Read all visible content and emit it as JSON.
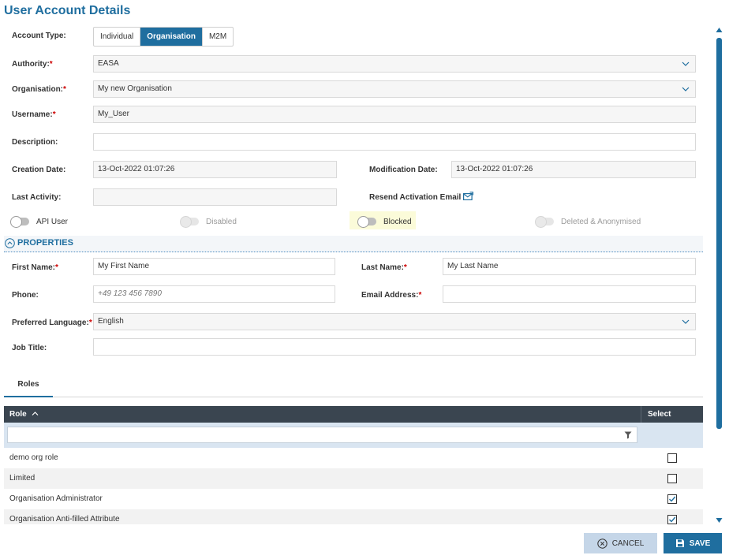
{
  "page": {
    "title": "User Account Details"
  },
  "account_type": {
    "label": "Account Type:",
    "options": [
      "Individual",
      "Organisation",
      "M2M"
    ],
    "selected": "Organisation"
  },
  "authority": {
    "label": "Authority:",
    "value": "EASA"
  },
  "organisation": {
    "label": "Organisation:",
    "value": "My new Organisation"
  },
  "username": {
    "label": "Username:",
    "value": "My_User"
  },
  "description": {
    "label": "Description:",
    "value": ""
  },
  "creation_date": {
    "label": "Creation Date:",
    "value": "13-Oct-2022 01:07:26"
  },
  "modification_date": {
    "label": "Modification Date:",
    "value": "13-Oct-2022 01:07:26"
  },
  "last_activity": {
    "label": "Last Activity:",
    "value": ""
  },
  "resend_activation": {
    "label": "Resend Activation Email"
  },
  "toggles": {
    "api_user": {
      "label": "API User",
      "on": false,
      "enabled": true
    },
    "disabled": {
      "label": "Disabled",
      "on": false,
      "enabled": false
    },
    "blocked": {
      "label": "Blocked",
      "on": false,
      "enabled": true,
      "highlight": "#fbfbd9"
    },
    "deleted": {
      "label": "Deleted & Anonymised",
      "on": false,
      "enabled": false
    }
  },
  "properties": {
    "header": "PROPERTIES",
    "first_name": {
      "label": "First Name:",
      "value": "My First Name"
    },
    "last_name": {
      "label": "Last Name:",
      "value": "My Last Name"
    },
    "phone": {
      "label": "Phone:",
      "placeholder": "+49 123 456 7890"
    },
    "email": {
      "label": "Email Address:",
      "value": ""
    },
    "language": {
      "label": "Preferred Language:",
      "value": "English"
    },
    "job_title": {
      "label": "Job Title:",
      "value": ""
    }
  },
  "tabs": {
    "roles": "Roles"
  },
  "roles_grid": {
    "col_role": "Role",
    "col_select": "Select",
    "rows": [
      {
        "name": "demo org role",
        "selected": false
      },
      {
        "name": "Limited",
        "selected": false
      },
      {
        "name": "Organisation Administrator",
        "selected": true
      },
      {
        "name": "Organisation Anti-filled Attribute",
        "selected": true
      }
    ]
  },
  "footer": {
    "cancel_label": "CANCEL",
    "save_label": "SAVE"
  },
  "colors": {
    "accent": "#1f6e9f",
    "grid_header": "#3a4550",
    "filter_bg": "#d9e5f1",
    "cancel_bg": "#c5d6e8",
    "required": "#cc0000"
  }
}
